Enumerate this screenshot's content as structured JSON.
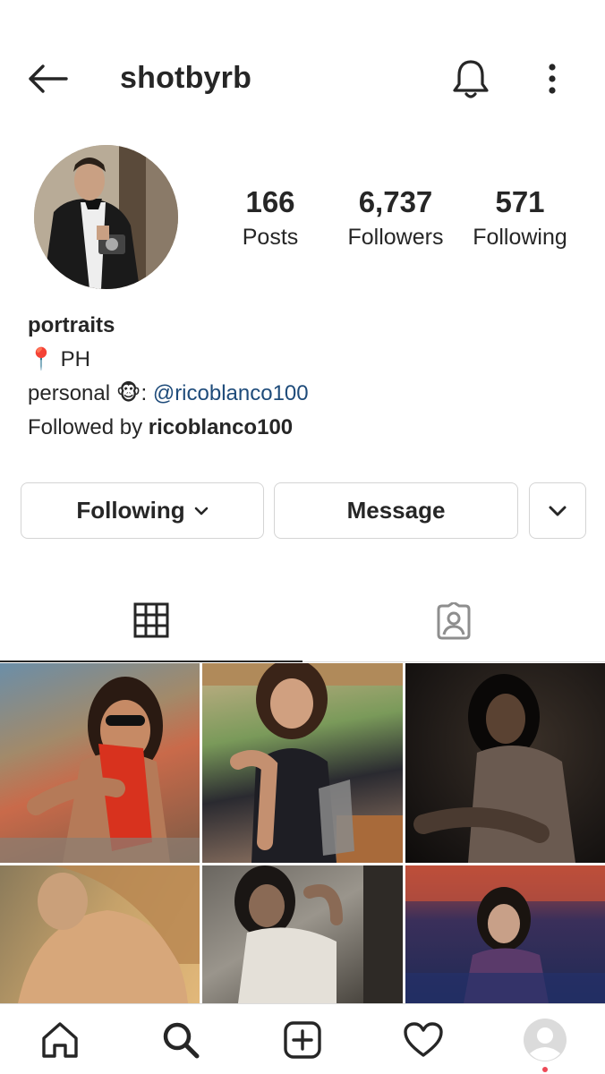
{
  "header": {
    "username": "shotbyrb",
    "back_icon": "arrow-left-icon",
    "notifications_icon": "bell-icon",
    "more_icon": "more-vertical-icon"
  },
  "profile": {
    "avatar_icon": "profile-photo",
    "stats": {
      "posts_count": "166",
      "posts_label": "Posts",
      "followers_count": "6,737",
      "followers_label": "Followers",
      "following_count": "571",
      "following_label": "Following"
    },
    "bio": {
      "name": "portraits",
      "location_emoji": "📍",
      "location": "PH",
      "personal_label": "personal",
      "personal_emoji": "🐵",
      "personal_separator": ":",
      "personal_handle": "@ricoblanco100",
      "followed_by_prefix": "Followed by",
      "followed_by_user": "ricoblanco100"
    }
  },
  "actions": {
    "following_label": "Following",
    "message_label": "Message"
  },
  "tabs": {
    "grid_icon": "grid-icon",
    "tagged_icon": "tagged-person-icon",
    "active": "grid"
  },
  "posts": [
    {
      "alt": "photo-1"
    },
    {
      "alt": "photo-2"
    },
    {
      "alt": "photo-3"
    },
    {
      "alt": "photo-4"
    },
    {
      "alt": "photo-5"
    },
    {
      "alt": "photo-6"
    }
  ],
  "bottom_nav": {
    "items": [
      "home-icon",
      "search-icon",
      "add-post-icon",
      "heart-icon",
      "profile-icon"
    ],
    "active": "profile-icon",
    "colors": {
      "badge": "#ed4956",
      "mention": "#1e4b7a",
      "text": "#262626"
    }
  }
}
